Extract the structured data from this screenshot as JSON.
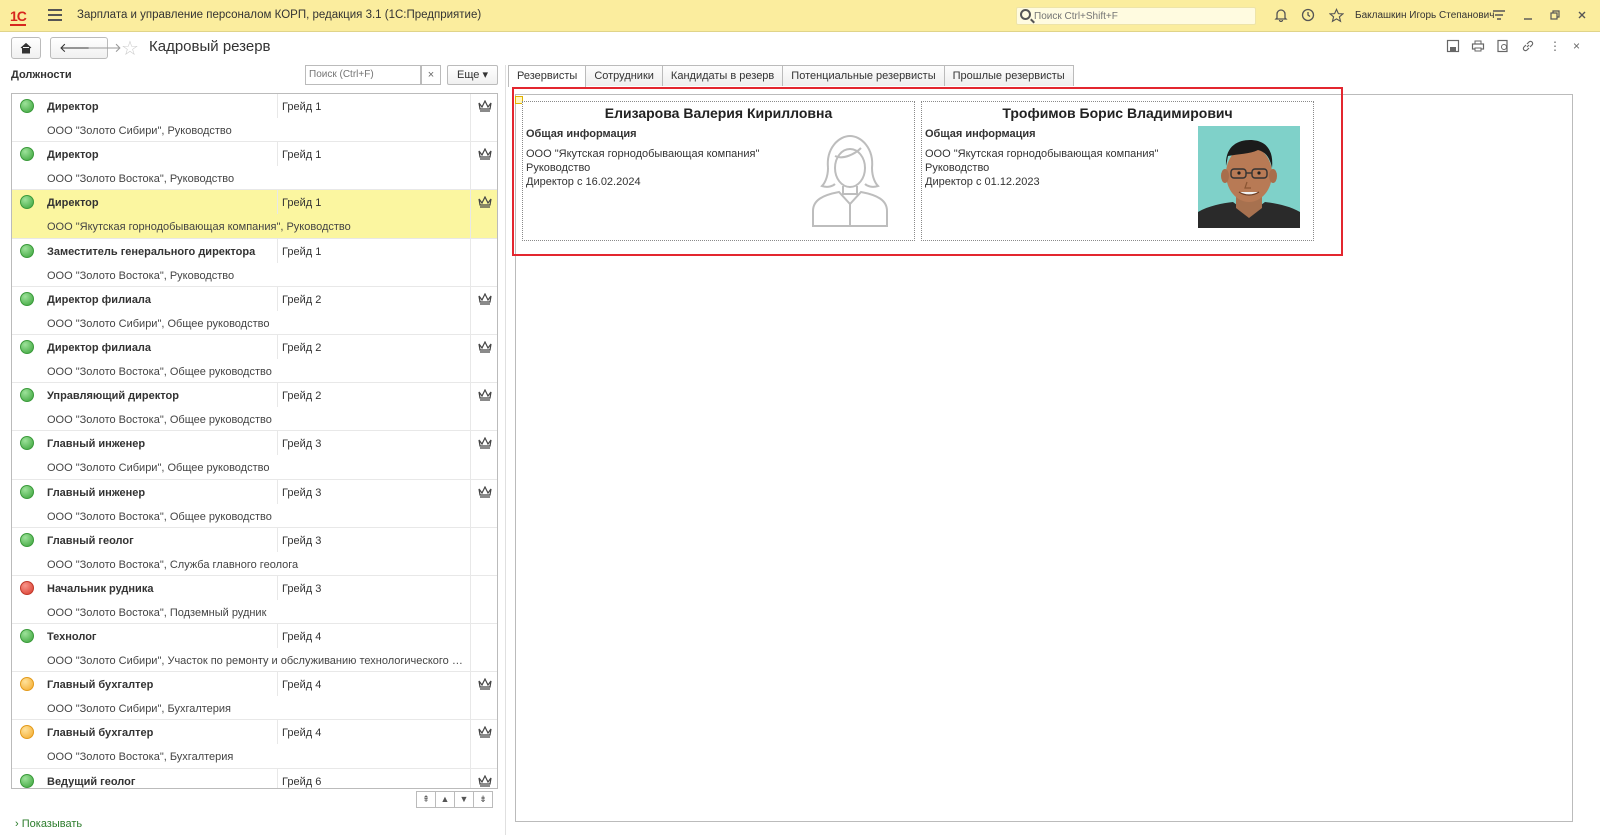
{
  "titlebar": {
    "logo": "1С",
    "app_title": "Зарплата и управление персоналом КОРП, редакция 3.1  (1С:Предприятие)",
    "search_placeholder": "Поиск Ctrl+Shift+F",
    "user": "Баклашкин Игорь Степанович"
  },
  "header": {
    "title": "Кадровый резерв"
  },
  "left": {
    "label": "Должности",
    "search_placeholder": "Поиск (Ctrl+F)",
    "clear_label": "×",
    "more_label": "Еще ▾",
    "show_label": "Показывать",
    "rows": [
      {
        "name": "Директор",
        "grade": "Грейд 1",
        "org": "ООО \"Золото Сибири\", Руководство",
        "status": "green",
        "crown": true,
        "selected": false
      },
      {
        "name": "Директор",
        "grade": "Грейд 1",
        "org": "ООО \"Золото Востока\", Руководство",
        "status": "green",
        "crown": true,
        "selected": false
      },
      {
        "name": "Директор",
        "grade": "Грейд 1",
        "org": "ООО \"Якутская горнодобывающая компания\", Руководство",
        "status": "green",
        "crown": true,
        "selected": true
      },
      {
        "name": "Заместитель генерального директора",
        "grade": "Грейд 1",
        "org": "ООО \"Золото Востока\", Руководство",
        "status": "green",
        "crown": false,
        "selected": false
      },
      {
        "name": "Директор филиала",
        "grade": "Грейд 2",
        "org": "ООО \"Золото Сибири\", Общее руководство",
        "status": "green",
        "crown": true,
        "selected": false
      },
      {
        "name": "Директор филиала",
        "grade": "Грейд 2",
        "org": "ООО \"Золото Востока\", Общее руководство",
        "status": "green",
        "crown": true,
        "selected": false
      },
      {
        "name": "Управляющий директор",
        "grade": "Грейд 2",
        "org": "ООО \"Золото Востока\", Общее руководство",
        "status": "green",
        "crown": true,
        "selected": false
      },
      {
        "name": "Главный инженер",
        "grade": "Грейд 3",
        "org": "ООО \"Золото Сибири\", Общее руководство",
        "status": "green",
        "crown": true,
        "selected": false
      },
      {
        "name": "Главный инженер",
        "grade": "Грейд 3",
        "org": "ООО \"Золото Востока\", Общее руководство",
        "status": "green",
        "crown": true,
        "selected": false
      },
      {
        "name": "Главный геолог",
        "grade": "Грейд 3",
        "org": "ООО \"Золото Востока\", Служба главного геолога",
        "status": "green",
        "crown": false,
        "selected": false
      },
      {
        "name": "Начальник рудника",
        "grade": "Грейд 3",
        "org": "ООО \"Золото Востока\", Подземный рудник",
        "status": "red",
        "crown": false,
        "selected": false
      },
      {
        "name": "Технолог",
        "grade": "Грейд 4",
        "org": "ООО \"Золото Сибири\", Участок по ремонту и обслуживанию технологического о...",
        "status": "green",
        "crown": false,
        "selected": false
      },
      {
        "name": "Главный бухгалтер",
        "grade": "Грейд 4",
        "org": "ООО \"Золото Сибири\", Бухгалтерия",
        "status": "orange",
        "crown": true,
        "selected": false
      },
      {
        "name": "Главный бухгалтер",
        "grade": "Грейд 4",
        "org": "ООО \"Золото Востока\", Бухгалтерия",
        "status": "orange",
        "crown": true,
        "selected": false
      },
      {
        "name": "Ведущий геолог",
        "grade": "Грейд 6",
        "org": "",
        "status": "green",
        "crown": true,
        "selected": false
      }
    ]
  },
  "tabs": [
    "Резервисты",
    "Сотрудники",
    "Кандидаты в резерв",
    "Потенциальные резервисты",
    "Прошлые резервисты"
  ],
  "cards": [
    {
      "fio": "Елизарова Валерия Кирилловна",
      "section": "Общая информация",
      "company": "ООО \"Якутская горнодобывающая компания\"",
      "dept": "Руководство",
      "since": "Директор с 16.02.2024",
      "photo": "female-placeholder-icon"
    },
    {
      "fio": "Трофимов Борис Владимирович",
      "section": "Общая информация",
      "company": "ООО \"Якутская горнодобывающая компания\"",
      "dept": "Руководство",
      "since": "Директор с 01.12.2023",
      "photo": "employee-photo"
    }
  ]
}
